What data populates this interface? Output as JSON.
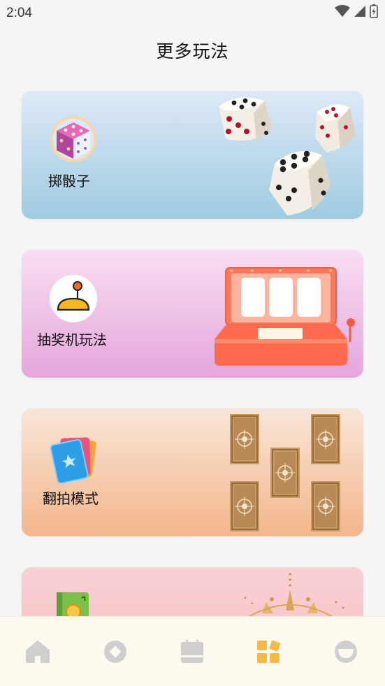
{
  "status_bar": {
    "time": "2:04",
    "icons": [
      "wifi-icon",
      "cellular-signal-icon",
      "battery-charging-icon"
    ]
  },
  "page": {
    "title": "更多玩法"
  },
  "cards": [
    {
      "label": "掷骰子",
      "icon": "dice-icon",
      "art": "three-dice-illustration",
      "bg": [
        "#dde9f7",
        "#9fcbe0"
      ]
    },
    {
      "label": "抽奖机玩法",
      "icon": "joystick-icon",
      "art": "slot-machine-illustration",
      "bg": [
        "#f8def2",
        "#e5a6dc"
      ]
    },
    {
      "label": "翻拍模式",
      "icon": "cards-icon",
      "art": "tarot-cards-illustration",
      "bg": [
        "#f8e6d8",
        "#f4b68b"
      ]
    },
    {
      "label": "",
      "icon": "book-icon",
      "art": "sun-astrology-illustration",
      "bg": [
        "#f8d0d4",
        "#f6c3c5"
      ]
    }
  ],
  "tabbar": {
    "items": [
      {
        "icon": "home-icon",
        "active": false
      },
      {
        "icon": "compass-icon",
        "active": false
      },
      {
        "icon": "calendar-icon",
        "active": false
      },
      {
        "icon": "more-games-icon",
        "active": true
      },
      {
        "icon": "profile-icon",
        "active": false
      }
    ],
    "active_color": "#f5b945",
    "inactive_color": "#cfcfcf"
  }
}
